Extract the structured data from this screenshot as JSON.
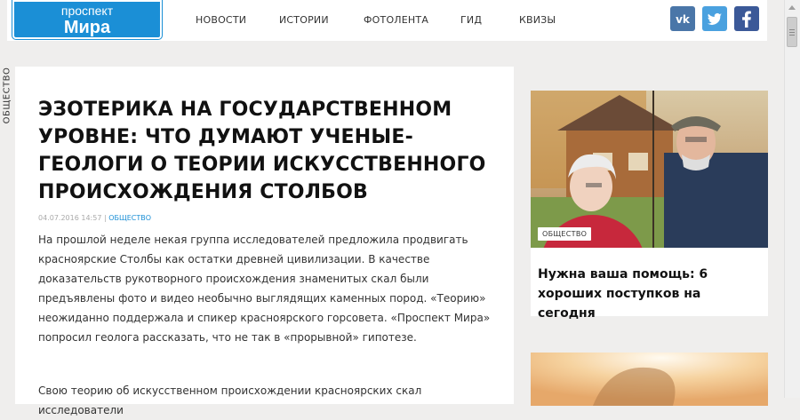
{
  "header": {
    "logo": {
      "line1": "проспект",
      "line2": "Мира"
    },
    "nav": [
      {
        "label": "НОВОСТИ"
      },
      {
        "label": "ИСТОРИИ"
      },
      {
        "label": "ФОТОЛЕНТА"
      },
      {
        "label": "ГИД"
      },
      {
        "label": "КВИЗЫ"
      }
    ],
    "social": [
      "vk-icon",
      "twitter-icon",
      "facebook-icon"
    ]
  },
  "colors": {
    "accent": "#1b8fd6",
    "vk": "#4a76a8",
    "twitter": "#4aa1df",
    "facebook": "#3b5998",
    "background": "#efeeed"
  },
  "side_label": "ОБЩЕСТВО",
  "article": {
    "title": "Эзотерика на государственном уровне: что думают ученые-геологи о теории искусственного происхождения Столбов",
    "date": "04.07.2016 14:57",
    "separator": "|",
    "category": "ОБЩЕСТВО",
    "paragraph1": "На прошлой неделе некая группа исследователей предложила продвигать красноярские Столбы как остатки древней цивилизации. В качестве доказательств рукотворного происхождения знаменитых скал были предъявлены фото и видео необычно выглядящих каменных пород. «Теорию» неожиданно поддержала и спикер красноярского горсовета. «Проспект Мира» попросил геолога рассказать, что не так в «прорывной» гипотезе.",
    "paragraph2": "Свою теорию об искусственном происхождении красноярских скал исследователи"
  },
  "sidebar": {
    "card1": {
      "image": "elderly-couple-photo",
      "badge": "ОБЩЕСТВО",
      "title": "Нужна ваша помощь: 6 хороших поступков на сегодня"
    },
    "card2": {
      "image": "sunset-photo"
    }
  }
}
